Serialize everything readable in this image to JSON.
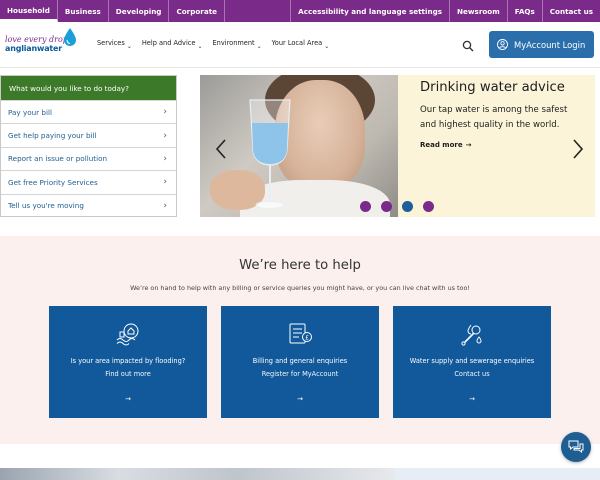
{
  "topbar": {
    "left": [
      {
        "label": "Household",
        "active": true
      },
      {
        "label": "Business",
        "active": false
      },
      {
        "label": "Developing",
        "active": false
      },
      {
        "label": "Corporate",
        "active": false
      }
    ],
    "right": [
      {
        "label": "Accessibility and language settings"
      },
      {
        "label": "Newsroom"
      },
      {
        "label": "FAQs"
      },
      {
        "label": "Contact us"
      }
    ]
  },
  "logo": {
    "line1": "love every drop",
    "line2": "anglianwater"
  },
  "nav": {
    "items": [
      {
        "label": "Services"
      },
      {
        "label": "Help and Advice"
      },
      {
        "label": "Environment"
      },
      {
        "label": "Your Local Area"
      }
    ],
    "myaccount_label": "MyAccount Login"
  },
  "quicklinks": {
    "heading": "What would you like to do today?",
    "items": [
      {
        "label": "Pay your bill"
      },
      {
        "label": "Get help paying your bill"
      },
      {
        "label": "Report an issue or pollution"
      },
      {
        "label": "Get free Priority Services"
      },
      {
        "label": "Tell us you're moving"
      }
    ]
  },
  "hero": {
    "title": "Drinking water advice",
    "body": "Our tap water is among the safest and highest quality in the world.",
    "link": "Read more",
    "slides_total": 4,
    "active_slide": 3
  },
  "help": {
    "title": "We’re here to help",
    "subtitle": "We’re on hand to help with any billing or service queries you might have, or you can live chat with us too!",
    "cards": [
      {
        "title": "Is your area impacted by flooding?",
        "link": "Find out more",
        "icon": "flood-icon"
      },
      {
        "title": "Billing and general enquiries",
        "link": "Register for MyAccount",
        "icon": "bill-icon"
      },
      {
        "title": "Water supply and sewerage enquiries",
        "link": "Contact us",
        "icon": "wrench-icon"
      }
    ]
  },
  "colors": {
    "brand_purple": "#7a2a89",
    "brand_blue": "#11599a",
    "brand_green": "#3c7a2a",
    "help_bg": "#fcf0ee",
    "hero_bg": "#fbf4d8"
  }
}
